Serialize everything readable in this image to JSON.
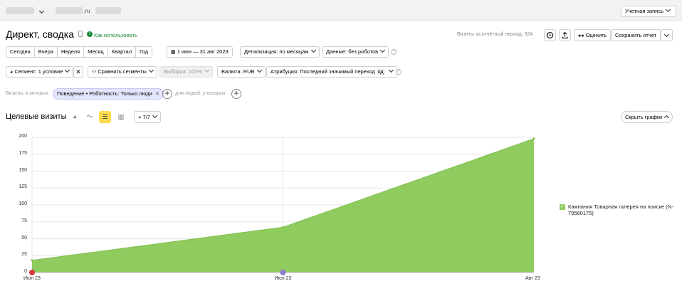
{
  "topbar": {
    "domain_suffix": ".ru",
    "account_button": "Учетная запись"
  },
  "header": {
    "title": "Директ, сводка",
    "howto_link": "Как использовать",
    "visits_info": "Визиты за отчётный период: 924",
    "rate_button": "Оценить",
    "save_button": "Сохранить отчет"
  },
  "periods": [
    "Сегодня",
    "Вчера",
    "Неделя",
    "Месяц",
    "Квартал",
    "Год"
  ],
  "date_range": "1 июн — 31 авг 2023",
  "detail": "Детализация: по месяцам",
  "data_filter": "Данные: без роботов",
  "segment": "Сегмент: 1 условие",
  "compare": "Сравнить сегменты",
  "sample": "Выборка: 100%",
  "currency": "Валюта: RUB",
  "attribution": "Атрибуция: Последний значимый переход",
  "attribution_badge": "кд",
  "filter_row": {
    "visits_in_which": "Визиты, в которых",
    "condition": "Поведение • Роботность: Только люди",
    "for_people": "для людей, у которых"
  },
  "chart_header": {
    "title": "Целевые визиты",
    "series_count": "7/7",
    "hide_chart": "Скрыть график"
  },
  "colors": {
    "accent": "#ffdb4d",
    "series": "#8fcb5f",
    "link": "#1b8a35"
  },
  "chart_data": {
    "type": "area",
    "x": [
      "Июн 23",
      "Июл 23",
      "Авг 23"
    ],
    "series": [
      {
        "name": "Кампания Товарная галерея на поиске (N-79560175)",
        "values": [
          18,
          67,
          198
        ]
      }
    ],
    "ylim": [
      0,
      200
    ],
    "yticks": [
      0,
      25,
      50,
      75,
      100,
      125,
      150,
      175,
      200
    ],
    "grid": true,
    "legend": "right"
  }
}
